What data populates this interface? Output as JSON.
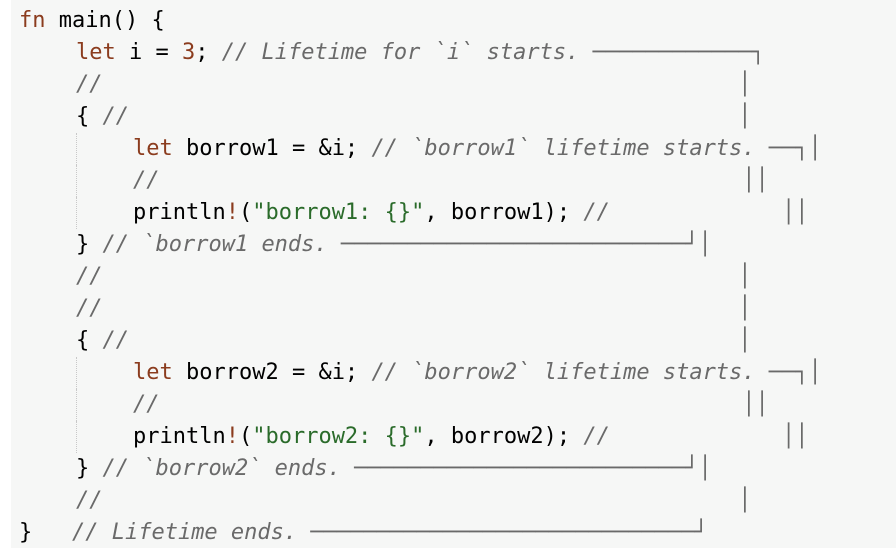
{
  "code": {
    "lines": [
      {
        "indent": 0,
        "guide": false,
        "tokens": [
          {
            "t": "kw",
            "v": "fn"
          },
          {
            "t": "plain",
            "v": " main() {"
          }
        ]
      },
      {
        "indent": 1,
        "guide": false,
        "tokens": [
          {
            "t": "kw",
            "v": "let"
          },
          {
            "t": "plain",
            "v": " i = "
          },
          {
            "t": "num",
            "v": "3"
          },
          {
            "t": "plain",
            "v": "; "
          },
          {
            "t": "cm",
            "v": "// Lifetime for `i` starts. ────────────┐"
          }
        ]
      },
      {
        "indent": 1,
        "guide": false,
        "tokens": [
          {
            "t": "cm",
            "v": "//                                                │"
          }
        ]
      },
      {
        "indent": 1,
        "guide": false,
        "tokens": [
          {
            "t": "plain",
            "v": "{ "
          },
          {
            "t": "cm",
            "v": "//                                              │"
          }
        ]
      },
      {
        "indent": 2,
        "guide": true,
        "tokens": [
          {
            "t": "kw",
            "v": "let"
          },
          {
            "t": "plain",
            "v": " borrow1 = &i; "
          },
          {
            "t": "cm",
            "v": "// `borrow1` lifetime starts. ──┐│"
          }
        ]
      },
      {
        "indent": 2,
        "guide": true,
        "tokens": [
          {
            "t": "cm",
            "v": "//                                            ││"
          }
        ]
      },
      {
        "indent": 2,
        "guide": true,
        "tokens": [
          {
            "t": "plain",
            "v": "println"
          },
          {
            "t": "mac",
            "v": "!"
          },
          {
            "t": "plain",
            "v": "("
          },
          {
            "t": "str",
            "v": "\"borrow1: {}\""
          },
          {
            "t": "plain",
            "v": ", borrow1); "
          },
          {
            "t": "cm",
            "v": "//             ││"
          }
        ]
      },
      {
        "indent": 1,
        "guide": false,
        "tokens": [
          {
            "t": "plain",
            "v": "} "
          },
          {
            "t": "cm",
            "v": "// `borrow1 ends. ──────────────────────────┘│"
          }
        ]
      },
      {
        "indent": 1,
        "guide": false,
        "tokens": [
          {
            "t": "cm",
            "v": "//                                                │"
          }
        ]
      },
      {
        "indent": 1,
        "guide": false,
        "tokens": [
          {
            "t": "cm",
            "v": "//                                                │"
          }
        ]
      },
      {
        "indent": 1,
        "guide": false,
        "tokens": [
          {
            "t": "plain",
            "v": "{ "
          },
          {
            "t": "cm",
            "v": "//                                              │"
          }
        ]
      },
      {
        "indent": 2,
        "guide": true,
        "tokens": [
          {
            "t": "kw",
            "v": "let"
          },
          {
            "t": "plain",
            "v": " borrow2 = &i; "
          },
          {
            "t": "cm",
            "v": "// `borrow2` lifetime starts. ──┐│"
          }
        ]
      },
      {
        "indent": 2,
        "guide": true,
        "tokens": [
          {
            "t": "cm",
            "v": "//                                            ││"
          }
        ]
      },
      {
        "indent": 2,
        "guide": true,
        "tokens": [
          {
            "t": "plain",
            "v": "println"
          },
          {
            "t": "mac",
            "v": "!"
          },
          {
            "t": "plain",
            "v": "("
          },
          {
            "t": "str",
            "v": "\"borrow2: {}\""
          },
          {
            "t": "plain",
            "v": ", borrow2); "
          },
          {
            "t": "cm",
            "v": "//             ││"
          }
        ]
      },
      {
        "indent": 1,
        "guide": false,
        "tokens": [
          {
            "t": "plain",
            "v": "} "
          },
          {
            "t": "cm",
            "v": "// `borrow2` ends. ─────────────────────────┘│"
          }
        ]
      },
      {
        "indent": 1,
        "guide": false,
        "tokens": [
          {
            "t": "cm",
            "v": "//                                                │"
          }
        ]
      },
      {
        "indent": 0,
        "guide": false,
        "tokens": [
          {
            "t": "plain",
            "v": "}   "
          },
          {
            "t": "cm",
            "v": "// Lifetime ends. ─────────────────────────────┘"
          }
        ]
      }
    ]
  }
}
